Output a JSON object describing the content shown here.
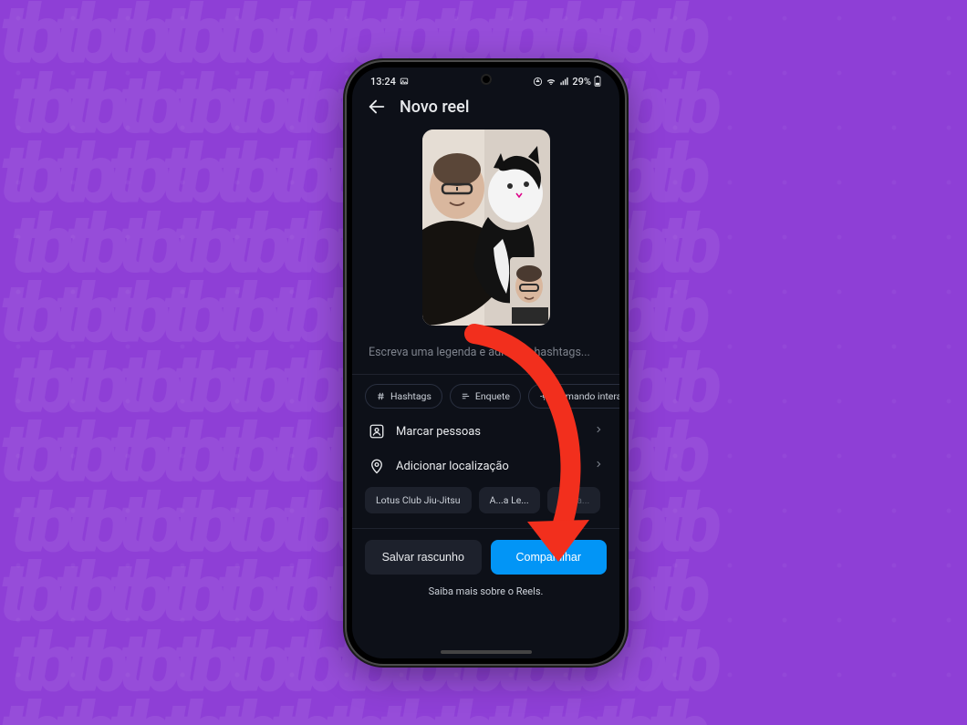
{
  "statusbar": {
    "time": "13:24",
    "battery_text": "29%"
  },
  "header": {
    "title": "Novo reel"
  },
  "caption": {
    "placeholder": "Escreva uma legenda e adicione hashtags..."
  },
  "chips": {
    "hashtags": "Hashtags",
    "poll": "Enquete",
    "interactive": "Comando interativo"
  },
  "rows": {
    "tag_people": "Marcar pessoas",
    "add_location": "Adicionar localização"
  },
  "location_suggestions": {
    "a": "Lotus Club Jiu-Jitsu",
    "b": "A...a Le...",
    "c": "Tatua..."
  },
  "actions": {
    "save_draft": "Salvar rascunho",
    "share": "Compartilhar"
  },
  "footer": {
    "learn_more": "Saiba mais sobre o Reels."
  },
  "colors": {
    "accent": "#0295f6",
    "annotation": "#f22f1d",
    "bg_purple": "#8e3fd6"
  }
}
